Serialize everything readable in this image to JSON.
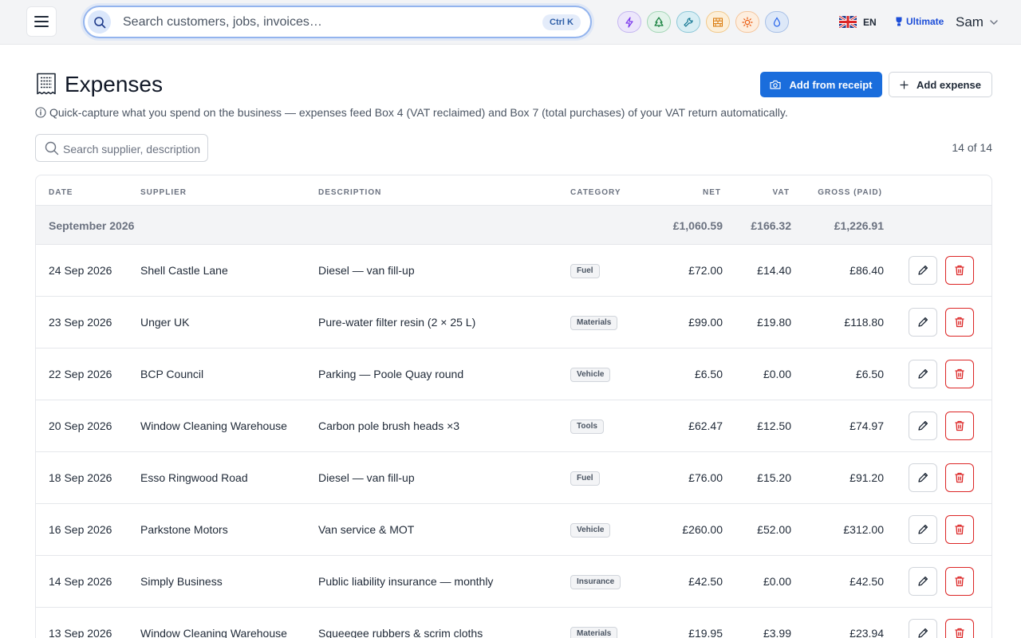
{
  "topbar": {
    "search_placeholder": "Search customers, jobs, invoices…",
    "search_shortcut": "Ctrl K",
    "quick_chips": [
      "lightning-icon",
      "tree-icon",
      "wrench-icon",
      "brick-wall-icon",
      "sun-icon",
      "droplet-icon"
    ],
    "language_code": "EN",
    "plan_label": "Ultimate",
    "user_name": "Sam"
  },
  "page": {
    "title": "Expenses",
    "add_receipt_label": "Add from receipt",
    "add_expense_label": "Add expense",
    "hint": "Quick-capture what you spend on the business — expenses feed Box 4 (VAT reclaimed) and Box 7 (total purchases) of your VAT return automatically.",
    "filter_placeholder": "Search supplier, description,",
    "count": "14 of 14"
  },
  "table": {
    "columns": {
      "date": "DATE",
      "supplier": "SUPPLIER",
      "description": "DESCRIPTION",
      "category": "CATEGORY",
      "net": "NET",
      "vat": "VAT",
      "gross": "GROSS (PAID)"
    },
    "group": {
      "label": "September 2026",
      "net": "£1,060.59",
      "vat": "£166.32",
      "gross": "£1,226.91"
    },
    "rows": [
      {
        "date": "24 Sep 2026",
        "supplier": "Shell Castle Lane",
        "description": "Diesel — van fill-up",
        "category": "Fuel",
        "net": "£72.00",
        "vat": "£14.40",
        "gross": "£86.40"
      },
      {
        "date": "23 Sep 2026",
        "supplier": "Unger UK",
        "description": "Pure-water filter resin (2 × 25 L)",
        "category": "Materials",
        "net": "£99.00",
        "vat": "£19.80",
        "gross": "£118.80"
      },
      {
        "date": "22 Sep 2026",
        "supplier": "BCP Council",
        "description": "Parking — Poole Quay round",
        "category": "Vehicle",
        "net": "£6.50",
        "vat": "£0.00",
        "gross": "£6.50"
      },
      {
        "date": "20 Sep 2026",
        "supplier": "Window Cleaning Warehouse",
        "description": "Carbon pole brush heads ×3",
        "category": "Tools",
        "net": "£62.47",
        "vat": "£12.50",
        "gross": "£74.97"
      },
      {
        "date": "18 Sep 2026",
        "supplier": "Esso Ringwood Road",
        "description": "Diesel — van fill-up",
        "category": "Fuel",
        "net": "£76.00",
        "vat": "£15.20",
        "gross": "£91.20"
      },
      {
        "date": "16 Sep 2026",
        "supplier": "Parkstone Motors",
        "description": "Van service & MOT",
        "category": "Vehicle",
        "net": "£260.00",
        "vat": "£52.00",
        "gross": "£312.00"
      },
      {
        "date": "14 Sep 2026",
        "supplier": "Simply Business",
        "description": "Public liability insurance — monthly",
        "category": "Insurance",
        "net": "£42.50",
        "vat": "£0.00",
        "gross": "£42.50"
      },
      {
        "date": "13 Sep 2026",
        "supplier": "Window Cleaning Warehouse",
        "description": "Squeegee rubbers & scrim cloths",
        "category": "Materials",
        "net": "£19.95",
        "vat": "£3.99",
        "gross": "£23.94"
      }
    ]
  },
  "colors": {
    "primary": "#1a6ddc",
    "danger": "#dc2626",
    "plan": "#1d4ed8"
  }
}
